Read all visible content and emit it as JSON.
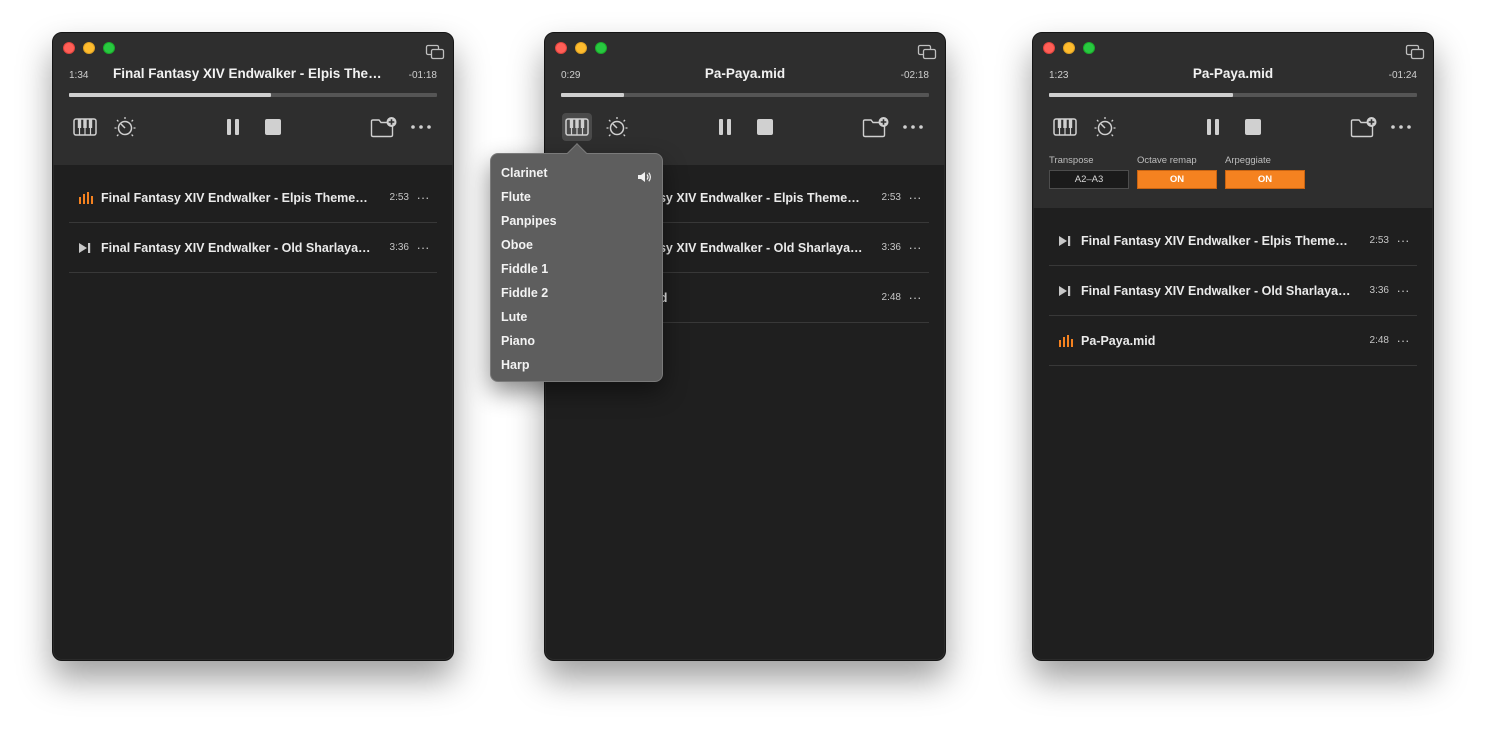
{
  "colors": {
    "accent": "#f58220",
    "window_bg": "#1f1f1f",
    "header_bg": "#2e2e2e",
    "popover_bg": "#5e5e5e"
  },
  "windows": [
    {
      "elapsed": "1:34",
      "title": "Final Fantasy XIV Endwalker - Elpis Theme.mid",
      "remaining": "-01:18",
      "progress": 0.55,
      "tracks": [
        {
          "title": "Final Fantasy XIV Endwalker - Elpis Theme.mid",
          "duration": "2:53",
          "state_icon": "playing-bars-icon"
        },
        {
          "title": "Final Fantasy XIV Endwalker - Old Sharlayan.mid",
          "duration": "3:36",
          "state_icon": "play-next-icon"
        }
      ]
    },
    {
      "elapsed": "0:29",
      "title": "Pa-Paya.mid",
      "remaining": "-02:18",
      "progress": 0.17,
      "tracks": [
        {
          "title": "Final Fantasy XIV Endwalker - Elpis Theme.mid",
          "duration": "2:53"
        },
        {
          "title": "Final Fantasy XIV Endwalker - Old Sharlayan.mid",
          "duration": "3:36"
        },
        {
          "title": "Pa-Paya.mid",
          "duration": "2:48"
        }
      ],
      "instrument_menu": {
        "items": [
          "Clarinet",
          "Flute",
          "Panpipes",
          "Oboe",
          "Fiddle 1",
          "Fiddle 2",
          "Lute",
          "Piano",
          "Harp"
        ],
        "selected": "Clarinet",
        "selected_icon": "speaker-icon"
      }
    },
    {
      "elapsed": "1:23",
      "title": "Pa-Paya.mid",
      "remaining": "-01:24",
      "progress": 0.5,
      "params": {
        "transpose_label": "Transpose",
        "transpose_value": "A2–A3",
        "octave_label": "Octave remap",
        "octave_value": "ON",
        "arp_label": "Arpeggiate",
        "arp_value": "ON"
      },
      "tracks": [
        {
          "title": "Final Fantasy XIV Endwalker - Elpis Theme.mid",
          "duration": "2:53",
          "state_icon": "play-next-icon"
        },
        {
          "title": "Final Fantasy XIV Endwalker - Old Sharlayan.mid",
          "duration": "3:36",
          "state_icon": "play-next-icon"
        },
        {
          "title": "Pa-Paya.mid",
          "duration": "2:48",
          "state_icon": "playing-bars-icon"
        }
      ]
    }
  ],
  "row_more_label": "···"
}
